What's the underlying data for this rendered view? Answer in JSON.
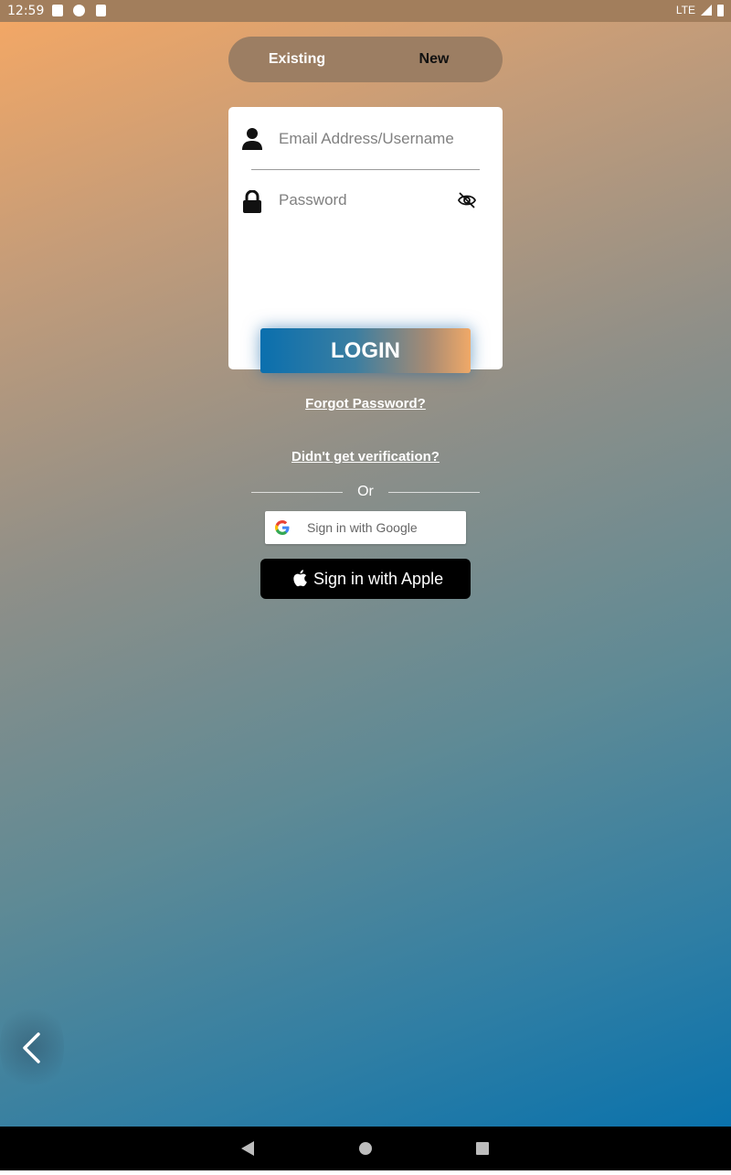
{
  "status_bar": {
    "time": "12:59",
    "network": "LTE"
  },
  "segment": {
    "existing_label": "Existing",
    "new_label": "New"
  },
  "login_form": {
    "username_placeholder": "Email Address/Username",
    "password_placeholder": "Password",
    "login_label": "LOGIN"
  },
  "links": {
    "forgot_password": "Forgot Password?",
    "verification": "Didn't get verification?"
  },
  "divider_text": "Or",
  "social": {
    "google_label": "Sign in with Google",
    "apple_label": "Sign in with Apple"
  },
  "icons": {
    "user": "person-icon",
    "password": "lock-icon",
    "toggle_visibility": "eye-off-icon",
    "google": "google-logo-icon",
    "apple": "apple-logo-icon",
    "back": "chevron-left-icon"
  },
  "colors": {
    "gradient_top": "#f6a864",
    "gradient_bottom": "#0a72ac",
    "login_start": "#0a6fae",
    "login_end": "#f0a968"
  }
}
